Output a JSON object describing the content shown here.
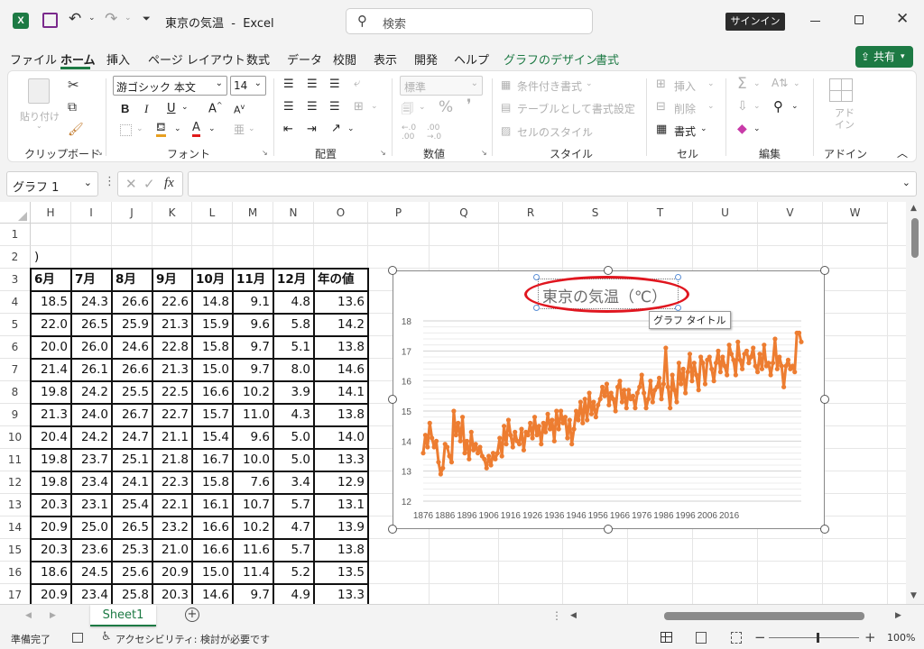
{
  "titlebar": {
    "title": "東京の気温  -  Excel",
    "search_placeholder": "検索",
    "signin_label": "サインイン"
  },
  "menu": {
    "items": [
      "ファイル",
      "ホーム",
      "挿入",
      "ページ レイアウト",
      "数式",
      "データ",
      "校閲",
      "表示",
      "開発",
      "ヘルプ",
      "グラフのデザイン",
      "書式"
    ],
    "share_label": "共有"
  },
  "ribbon": {
    "paste_label": "貼り付け",
    "font_name": "游ゴシック 本文",
    "font_size": "14",
    "number_format": "標準",
    "conditional_format": "条件付き書式",
    "format_as_table": "テーブルとして書式設定",
    "cell_styles": "セルのスタイル",
    "insert_label": "挿入",
    "delete_label": "削除",
    "format_label": "書式",
    "addin_label": "アド\nイン",
    "groups": {
      "clipboard": "クリップボード",
      "font": "フォント",
      "alignment": "配置",
      "number": "数値",
      "styles": "スタイル",
      "cells": "セル",
      "editing": "編集",
      "addins": "アドイン"
    }
  },
  "formula_bar": {
    "name_box": "グラフ 1",
    "formula": ""
  },
  "sheet": {
    "columns": [
      "H",
      "I",
      "J",
      "K",
      "L",
      "M",
      "N",
      "O",
      "P",
      "Q",
      "R",
      "S",
      "T",
      "U",
      "V",
      "W"
    ],
    "row_numbers": [
      "1",
      "2",
      "3",
      "4",
      "5",
      "6",
      "7",
      "8",
      "9",
      "10",
      "11",
      "12",
      "13",
      "14",
      "15",
      "16",
      "17"
    ],
    "row2_fragment": ")",
    "table_headers": [
      "6月",
      "7月",
      "8月",
      "9月",
      "10月",
      "11月",
      "12月",
      "年の値"
    ],
    "table_rows": [
      [
        "18.5",
        "24.3",
        "26.6",
        "22.6",
        "14.8",
        "9.1",
        "4.8",
        "13.6"
      ],
      [
        "22.0",
        "26.5",
        "25.9",
        "21.3",
        "15.9",
        "9.6",
        "5.8",
        "14.2"
      ],
      [
        "20.0",
        "26.0",
        "24.6",
        "22.8",
        "15.8",
        "9.7",
        "5.1",
        "13.8"
      ],
      [
        "21.4",
        "26.1",
        "26.6",
        "21.3",
        "15.0",
        "9.7",
        "8.0",
        "14.6"
      ],
      [
        "19.8",
        "24.2",
        "25.5",
        "22.5",
        "16.6",
        "10.2",
        "3.9",
        "14.1"
      ],
      [
        "21.3",
        "24.0",
        "26.7",
        "22.7",
        "15.7",
        "11.0",
        "4.3",
        "13.8"
      ],
      [
        "20.4",
        "24.2",
        "24.7",
        "21.1",
        "15.4",
        "9.6",
        "5.0",
        "14.0"
      ],
      [
        "19.8",
        "23.7",
        "25.1",
        "21.8",
        "16.7",
        "10.0",
        "5.0",
        "13.3"
      ],
      [
        "19.8",
        "23.4",
        "24.1",
        "22.3",
        "15.8",
        "7.6",
        "3.4",
        "12.9"
      ],
      [
        "20.3",
        "23.1",
        "25.4",
        "22.1",
        "16.1",
        "10.7",
        "5.7",
        "13.1"
      ],
      [
        "20.9",
        "25.0",
        "26.5",
        "23.2",
        "16.6",
        "10.2",
        "4.7",
        "13.9"
      ],
      [
        "20.3",
        "23.6",
        "25.3",
        "21.0",
        "16.6",
        "11.6",
        "5.7",
        "13.8"
      ],
      [
        "18.6",
        "24.5",
        "25.6",
        "20.9",
        "15.0",
        "11.4",
        "5.2",
        "13.5"
      ],
      [
        "20.9",
        "23.4",
        "25.8",
        "20.3",
        "14.6",
        "9.7",
        "4.9",
        "13.3"
      ]
    ]
  },
  "chart_tooltip": "グラフ タイトル",
  "chart_data": {
    "type": "line",
    "title": "東京の気温（℃）",
    "ylim": [
      12,
      18
    ],
    "yticks": [
      "18",
      "17",
      "16",
      "15",
      "14",
      "13",
      "12"
    ],
    "xticks": [
      "1876",
      "1886",
      "1896",
      "1906",
      "1916",
      "1926",
      "1936",
      "1946",
      "1956",
      "1966",
      "1976",
      "1986",
      "1996",
      "2006",
      "2016"
    ],
    "color": "#ed7d31",
    "title_highlight_color": "#e0161f",
    "series": [
      {
        "x_start": 1876,
        "values": [
          13.6,
          14.2,
          13.8,
          14.6,
          14.1,
          13.8,
          14.0,
          13.3,
          12.9,
          13.1,
          13.9,
          13.8,
          13.5,
          13.3,
          15.0,
          14.2,
          14.6,
          14.0,
          14.8,
          13.6,
          14.0,
          13.4,
          14.3,
          13.7,
          13.9,
          13.6,
          13.8,
          13.5,
          13.4,
          13.1,
          13.5,
          13.2,
          13.6,
          13.4,
          13.6,
          14.1,
          13.5,
          14.5,
          13.9,
          14.7,
          14.2,
          13.8,
          14.3,
          14.0,
          13.9,
          14.4,
          13.7,
          14.3,
          14.2,
          14.6,
          14.1,
          14.8,
          14.2,
          14.5,
          13.9,
          14.6,
          14.3,
          14.9,
          14.4,
          14.7,
          14.0,
          15.0,
          14.4,
          15.0,
          14.6,
          14.8,
          14.1,
          14.7,
          13.9,
          14.4,
          15.0,
          14.7,
          15.3,
          14.6,
          15.4,
          14.7,
          15.6,
          14.9,
          15.3,
          14.8,
          15.2,
          15.4,
          15.8,
          15.5,
          15.9,
          15.2,
          15.6,
          15.4,
          15.0,
          15.8,
          16.0,
          15.3,
          15.7,
          15.1,
          15.7,
          15.4,
          15.5,
          15.1,
          15.6,
          15.8,
          16.2,
          15.6,
          15.1,
          15.4,
          16.0,
          15.3,
          15.7,
          15.8,
          16.1,
          15.4,
          15.9,
          17.1,
          15.8,
          15.1,
          16.2,
          15.7,
          15.3,
          16.6,
          15.9,
          16.4,
          15.6,
          16.3,
          16.9,
          16.0,
          16.6,
          16.2,
          15.7,
          16.8,
          16.6,
          15.9,
          16.7,
          16.8,
          16.4,
          16.0,
          16.6,
          17.0,
          16.3,
          16.8,
          16.5,
          16.2,
          17.2,
          16.9,
          16.7,
          16.2,
          17.3,
          16.7,
          16.4,
          16.9,
          17.0,
          16.6,
          16.8,
          17.1,
          16.5,
          16.3,
          16.9,
          16.4,
          17.2,
          16.5,
          16.6,
          16.2,
          16.6,
          17.4,
          16.4,
          16.8,
          16.5,
          15.8,
          16.5,
          16.7,
          16.4,
          16.5,
          16.3,
          17.6,
          17.6,
          17.3
        ]
      }
    ]
  },
  "sheet_tab": "Sheet1",
  "status": {
    "ready": "準備完了",
    "accessibility": "アクセシビリティ: 検討が必要です",
    "zoom": "100%"
  }
}
